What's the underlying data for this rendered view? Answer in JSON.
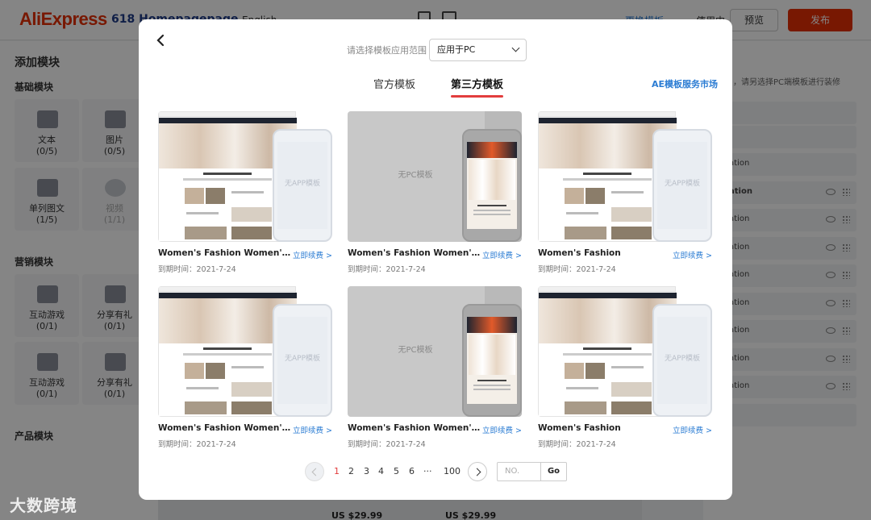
{
  "app": {
    "logo": "AliExpress",
    "page_name": "618 Homepagepage",
    "language": "English",
    "template_link": "更换模板",
    "status": "使用中",
    "preview_label": "预览",
    "publish_label": "发布"
  },
  "left_panel": {
    "title": "添加模块",
    "sections": [
      "基础模块",
      "营销模块",
      "产品模块"
    ],
    "basic_tiles": [
      {
        "name": "文本",
        "count": "(0/5)"
      },
      {
        "name": "图片",
        "count": "(0/5)"
      },
      {
        "name": "单列图文",
        "count": "(1/5)"
      },
      {
        "name": "视频",
        "count": "(1/1)"
      }
    ],
    "marketing_tiles": [
      {
        "name": "互动游戏",
        "count": "(0/1)"
      },
      {
        "name": "分享有礼",
        "count": "(0/1)"
      },
      {
        "name": "互动游戏",
        "count": "(0/1)"
      },
      {
        "name": "分享有礼",
        "count": "(0/1)"
      }
    ]
  },
  "right_panel": {
    "hint": "ﾞ，请另选择PC端模板进行装修",
    "rows": [
      "ation",
      "ation",
      "ation",
      "ation",
      "ation",
      "ation",
      "ation",
      "ation",
      "ation"
    ]
  },
  "prices": [
    "US $29.99",
    "US $29.99"
  ],
  "watermark": "大数跨境",
  "modal": {
    "scope_label": "请选择模板应用范围",
    "scope_value": "应用于PC",
    "tabs": [
      {
        "label": "官方模板",
        "active": false
      },
      {
        "label": "第三方模板",
        "active": true
      }
    ],
    "market_link": "AE模板服务市场",
    "no_pc_text": "无PC模板",
    "no_app_text": "无APP模板",
    "hero_caption": "Clothes with a personality.",
    "cards": [
      {
        "title": "Women's Fashion Women's Fashion",
        "renew": "立即续费 >",
        "expire": "到期时间：2021-7-24",
        "variant": "pc"
      },
      {
        "title": "Women's Fashion Women's Fashion",
        "renew": "立即续费 >",
        "expire": "到期时间：2021-7-24",
        "variant": "app"
      },
      {
        "title": "Women's Fashion",
        "renew": "立即续费 >",
        "expire": "到期时间：2021-7-24",
        "variant": "pc"
      },
      {
        "title": "Women's Fashion Women's Fashion",
        "renew": "立即续费 >",
        "expire": "到期时间：2021-7-24",
        "variant": "pc"
      },
      {
        "title": "Women's Fashion Women's Fashion",
        "renew": "立即续费 >",
        "expire": "到期时间：2021-7-24",
        "variant": "app"
      },
      {
        "title": "Women's Fashion",
        "renew": "立即续费 >",
        "expire": "到期时间：2021-7-24",
        "variant": "pc"
      }
    ],
    "pagination": {
      "pages": [
        "1",
        "2",
        "3",
        "4",
        "5",
        "6",
        "···",
        "100"
      ],
      "current": "1",
      "input_placeholder": "NO.",
      "go_label": "Go"
    }
  },
  "colors": {
    "brand_red": "#e62e04",
    "accent_red": "#e23d3d",
    "link_blue": "#2b7cd3"
  }
}
